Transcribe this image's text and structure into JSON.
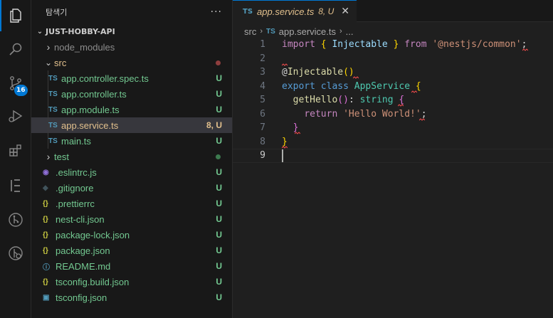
{
  "activity_bar": {
    "items": [
      {
        "name": "explorer-icon",
        "active": true
      },
      {
        "name": "search-icon"
      },
      {
        "name": "source-control-icon",
        "badge": "16"
      },
      {
        "name": "run-debug-icon"
      },
      {
        "name": "extensions-icon"
      },
      {
        "name": "elementor-icon"
      },
      {
        "name": "git-graph-icon"
      },
      {
        "name": "git-history-icon"
      }
    ]
  },
  "sidebar": {
    "title": "탐색기",
    "more": "···",
    "project": "JUST-HOBBY-API",
    "tree": [
      {
        "label": "node_modules",
        "type": "folder",
        "expanded": false,
        "depth": 1,
        "status": "",
        "color": "#8c8c8c"
      },
      {
        "label": "src",
        "type": "folder",
        "expanded": true,
        "depth": 1,
        "status": "dot",
        "dot_color": "#8e3e3e",
        "color": "#e2c08d"
      },
      {
        "label": "app.controller.spec.ts",
        "type": "ts",
        "depth": 2,
        "status": "U",
        "color": "#73c991"
      },
      {
        "label": "app.controller.ts",
        "type": "ts",
        "depth": 2,
        "status": "U",
        "color": "#73c991"
      },
      {
        "label": "app.module.ts",
        "type": "ts",
        "depth": 2,
        "status": "U",
        "color": "#73c991"
      },
      {
        "label": "app.service.ts",
        "type": "ts",
        "depth": 2,
        "status": "8, U",
        "color": "#e2c08d",
        "selected": true
      },
      {
        "label": "main.ts",
        "type": "ts",
        "depth": 2,
        "status": "U",
        "color": "#73c991"
      },
      {
        "label": "test",
        "type": "folder",
        "expanded": false,
        "depth": 1,
        "status": "dot",
        "dot_color": "#3d7a4f",
        "color": "#73c991"
      },
      {
        "label": ".eslintrc.js",
        "type": "eslint",
        "depth": 1,
        "status": "U",
        "color": "#73c991"
      },
      {
        "label": ".gitignore",
        "type": "git",
        "depth": 1,
        "status": "U",
        "color": "#73c991"
      },
      {
        "label": ".prettierrc",
        "type": "json",
        "depth": 1,
        "status": "U",
        "color": "#73c991"
      },
      {
        "label": "nest-cli.json",
        "type": "json",
        "depth": 1,
        "status": "U",
        "color": "#73c991"
      },
      {
        "label": "package-lock.json",
        "type": "json",
        "depth": 1,
        "status": "U",
        "color": "#73c991"
      },
      {
        "label": "package.json",
        "type": "json",
        "depth": 1,
        "status": "U",
        "color": "#73c991"
      },
      {
        "label": "README.md",
        "type": "info",
        "depth": 1,
        "status": "U",
        "color": "#73c991"
      },
      {
        "label": "tsconfig.build.json",
        "type": "json",
        "depth": 1,
        "status": "U",
        "color": "#73c991"
      },
      {
        "label": "tsconfig.json",
        "type": "tsconfig",
        "depth": 1,
        "status": "U",
        "color": "#73c991"
      }
    ]
  },
  "editor": {
    "tab": {
      "prefix": "TS",
      "name": "app.service.ts",
      "badge": "8, U",
      "close": "✕"
    },
    "breadcrumb": {
      "folder": "src",
      "prefix": "TS",
      "file": "app.service.ts",
      "more": "..."
    },
    "current_line": 9,
    "lines": [
      {
        "n": "1",
        "tokens": [
          [
            "kw",
            "import"
          ],
          [
            "plain",
            " "
          ],
          [
            "br1",
            "{"
          ],
          [
            "plain",
            " "
          ],
          [
            "id",
            "Injectable"
          ],
          [
            "plain",
            " "
          ],
          [
            "br1",
            "}"
          ],
          [
            "plain",
            " "
          ],
          [
            "kw",
            "from"
          ],
          [
            "plain",
            " "
          ],
          [
            "str",
            "'@nestjs/common'"
          ],
          [
            "plain",
            ";"
          ]
        ]
      },
      {
        "n": "2",
        "tokens": []
      },
      {
        "n": "3",
        "tokens": [
          [
            "plain",
            "@"
          ],
          [
            "fn",
            "Injectable"
          ],
          [
            "br1",
            "()"
          ]
        ]
      },
      {
        "n": "4",
        "tokens": [
          [
            "kw2",
            "export"
          ],
          [
            "plain",
            " "
          ],
          [
            "kw2",
            "class"
          ],
          [
            "plain",
            " "
          ],
          [
            "cls",
            "AppService"
          ],
          [
            "plain",
            " "
          ],
          [
            "br1",
            "{"
          ]
        ]
      },
      {
        "n": "5",
        "tokens": [
          [
            "plain",
            "  "
          ],
          [
            "fn",
            "getHello"
          ],
          [
            "br2",
            "()"
          ],
          [
            "plain",
            ": "
          ],
          [
            "cls",
            "string"
          ],
          [
            "plain",
            " "
          ],
          [
            "br2",
            "{"
          ]
        ]
      },
      {
        "n": "6",
        "tokens": [
          [
            "plain",
            "    "
          ],
          [
            "kw",
            "return"
          ],
          [
            "plain",
            " "
          ],
          [
            "str",
            "'Hello World!'"
          ],
          [
            "plain",
            ";"
          ]
        ]
      },
      {
        "n": "7",
        "tokens": [
          [
            "plain",
            "  "
          ],
          [
            "br2",
            "}"
          ]
        ]
      },
      {
        "n": "8",
        "tokens": [
          [
            "br1",
            "}"
          ]
        ]
      },
      {
        "n": "9",
        "tokens": []
      }
    ]
  }
}
